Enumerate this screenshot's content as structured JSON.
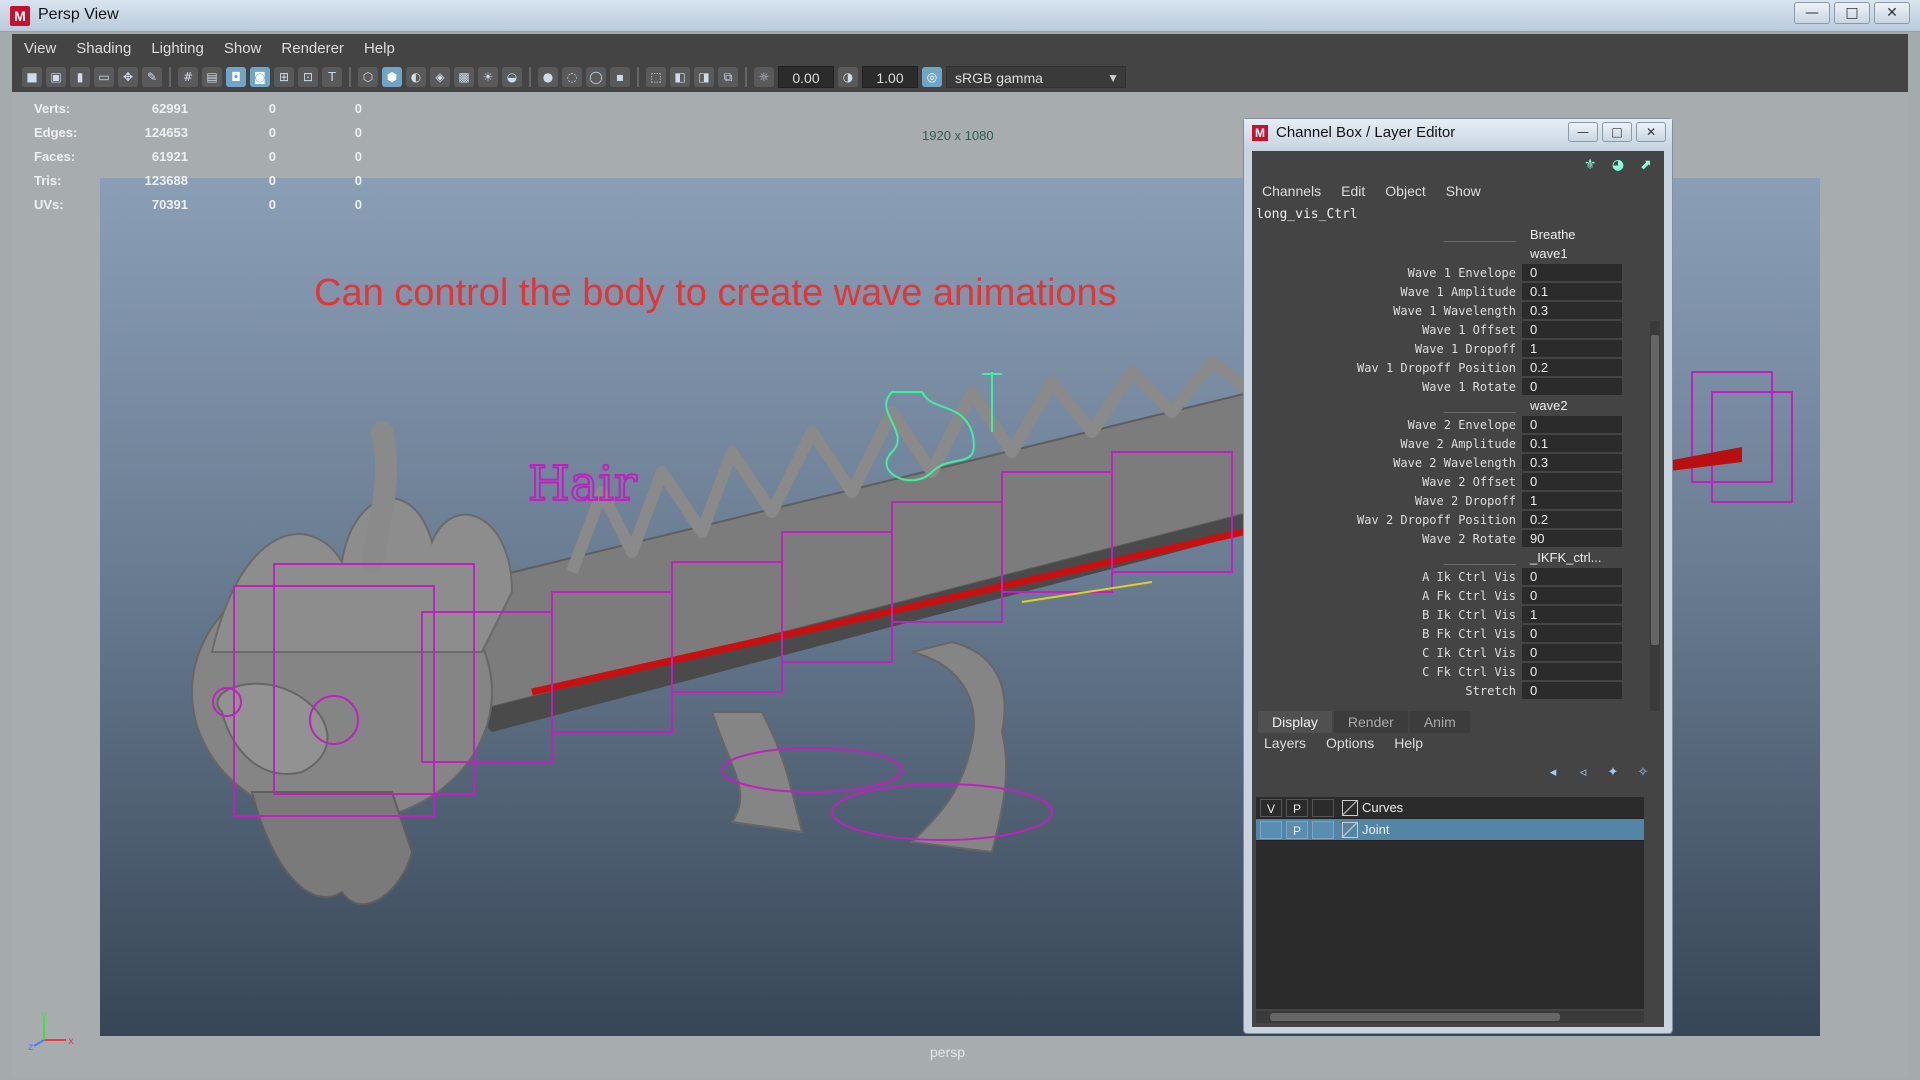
{
  "window": {
    "title": "Persp View",
    "app_icon": "M",
    "min": "—",
    "max": "□",
    "close": "✕"
  },
  "menu": [
    "View",
    "Shading",
    "Lighting",
    "Show",
    "Renderer",
    "Help"
  ],
  "toolbar": {
    "exposure": "0.00",
    "gamma": "1.00",
    "color_space": "sRGB gamma"
  },
  "hud": {
    "rows": [
      {
        "label": "Verts:",
        "value": "62991",
        "z1": "0",
        "z2": "0"
      },
      {
        "label": "Edges:",
        "value": "124653",
        "z1": "0",
        "z2": "0"
      },
      {
        "label": "Faces:",
        "value": "61921",
        "z1": "0",
        "z2": "0"
      },
      {
        "label": "Tris:",
        "value": "123688",
        "z1": "0",
        "z2": "0"
      },
      {
        "label": "UVs:",
        "value": "70391",
        "z1": "0",
        "z2": "0"
      }
    ]
  },
  "viewport": {
    "resolution": "1920 x 1080",
    "caption": "Can control the body to create wave animations",
    "camera": "persp",
    "hair_label": "Hair",
    "axis_x": "x",
    "axis_y": "y",
    "axis_z": "z"
  },
  "channel_box": {
    "title": "Channel Box / Layer Editor",
    "menu": [
      "Channels",
      "Edit",
      "Object",
      "Show"
    ],
    "object": "long_vis_Ctrl",
    "attributes": [
      {
        "label": "__________",
        "value": "Breathe",
        "sep": true
      },
      {
        "label": "",
        "value": "wave1",
        "sep": true
      },
      {
        "label": "Wave 1 Envelope",
        "value": "0"
      },
      {
        "label": "Wave 1 Amplitude",
        "value": "0.1"
      },
      {
        "label": "Wave 1 Wavelength",
        "value": "0.3"
      },
      {
        "label": "Wave 1 Offset",
        "value": "0"
      },
      {
        "label": "Wave 1 Dropoff",
        "value": "1"
      },
      {
        "label": "Wav 1 Dropoff Position",
        "value": "0.2"
      },
      {
        "label": "Wave 1 Rotate",
        "value": "0"
      },
      {
        "label": "__________",
        "value": "wave2",
        "sep": true
      },
      {
        "label": "Wave 2 Envelope",
        "value": "0"
      },
      {
        "label": "Wave 2 Amplitude",
        "value": "0.1"
      },
      {
        "label": "Wave 2 Wavelength",
        "value": "0.3"
      },
      {
        "label": "Wave 2 Offset",
        "value": "0"
      },
      {
        "label": "Wave 2 Dropoff",
        "value": "1"
      },
      {
        "label": "Wav 2 Dropoff Position",
        "value": "0.2"
      },
      {
        "label": "Wave 2 Rotate",
        "value": "90"
      },
      {
        "label": "__________",
        "value": "_IKFK_ctrl...",
        "sep": true
      },
      {
        "label": "A Ik Ctrl Vis",
        "value": "0"
      },
      {
        "label": "A Fk Ctrl Vis",
        "value": "0"
      },
      {
        "label": "B Ik Ctrl Vis",
        "value": "1"
      },
      {
        "label": "B Fk Ctrl Vis",
        "value": "0"
      },
      {
        "label": "C Ik Ctrl Vis",
        "value": "0"
      },
      {
        "label": "C Fk Ctrl Vis",
        "value": "0"
      },
      {
        "label": "Stretch",
        "value": "0"
      }
    ]
  },
  "layer_editor": {
    "tabs": [
      "Display",
      "Render",
      "Anim"
    ],
    "menu": [
      "Layers",
      "Options",
      "Help"
    ],
    "layers": [
      {
        "v": "V",
        "p": "P",
        "name": "Curves",
        "selected": false
      },
      {
        "v": "",
        "p": "P",
        "name": "Joint",
        "selected": true
      }
    ]
  },
  "colors": {
    "caption": "#e43434",
    "selection": "#5285a6",
    "control_curve": "#c020c0"
  }
}
